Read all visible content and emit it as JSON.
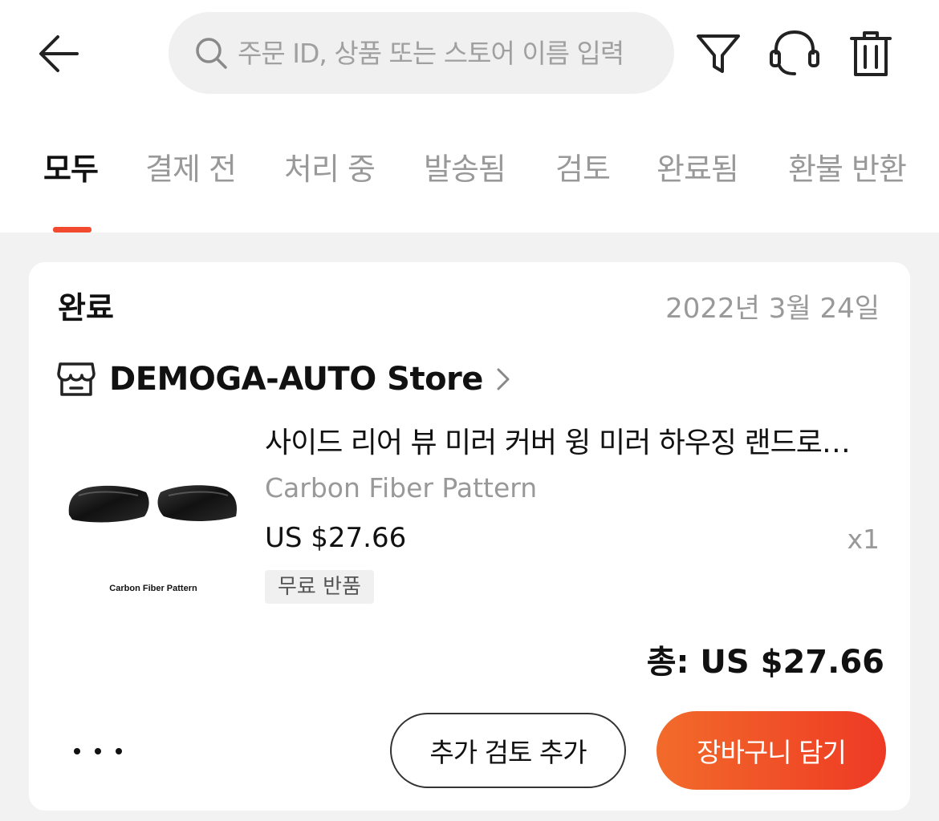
{
  "header": {
    "back_icon": "arrow-left-icon",
    "search": {
      "placeholder": "주문 ID, 상품 또는 스토어 이름 입력",
      "value": ""
    },
    "actions": [
      "filter-icon",
      "headset-icon",
      "trash-icon"
    ]
  },
  "tabs": [
    {
      "label": "모두",
      "active": true
    },
    {
      "label": "결제 전",
      "active": false
    },
    {
      "label": "처리 중",
      "active": false
    },
    {
      "label": "발송됨",
      "active": false
    },
    {
      "label": "검토",
      "active": false
    },
    {
      "label": "완료됨",
      "active": false
    },
    {
      "label": "환불 반환",
      "active": false
    }
  ],
  "order": {
    "status": "완료",
    "date": "2022년 3월 24일",
    "store": {
      "name": "DEMOGA-AUTO Store"
    },
    "item": {
      "title": "사이드 리어 뷰 미러 커버 윙 미러 하우징 랜드로버 디스커버리 스포츠",
      "variant": "Carbon Fiber Pattern",
      "price": "US $27.66",
      "quantity": "x1",
      "badge": "무료 반품",
      "image_caption": "Carbon Fiber Pattern"
    },
    "total": "총: US $27.66",
    "actions": {
      "review_label": "추가 검토 추가",
      "cart_label": "장바구니 담기"
    }
  },
  "colors": {
    "accent": "#f24a2e",
    "primary_gradient_start": "#f26b2a",
    "primary_gradient_end": "#ee3a25",
    "muted_text": "#999999"
  }
}
